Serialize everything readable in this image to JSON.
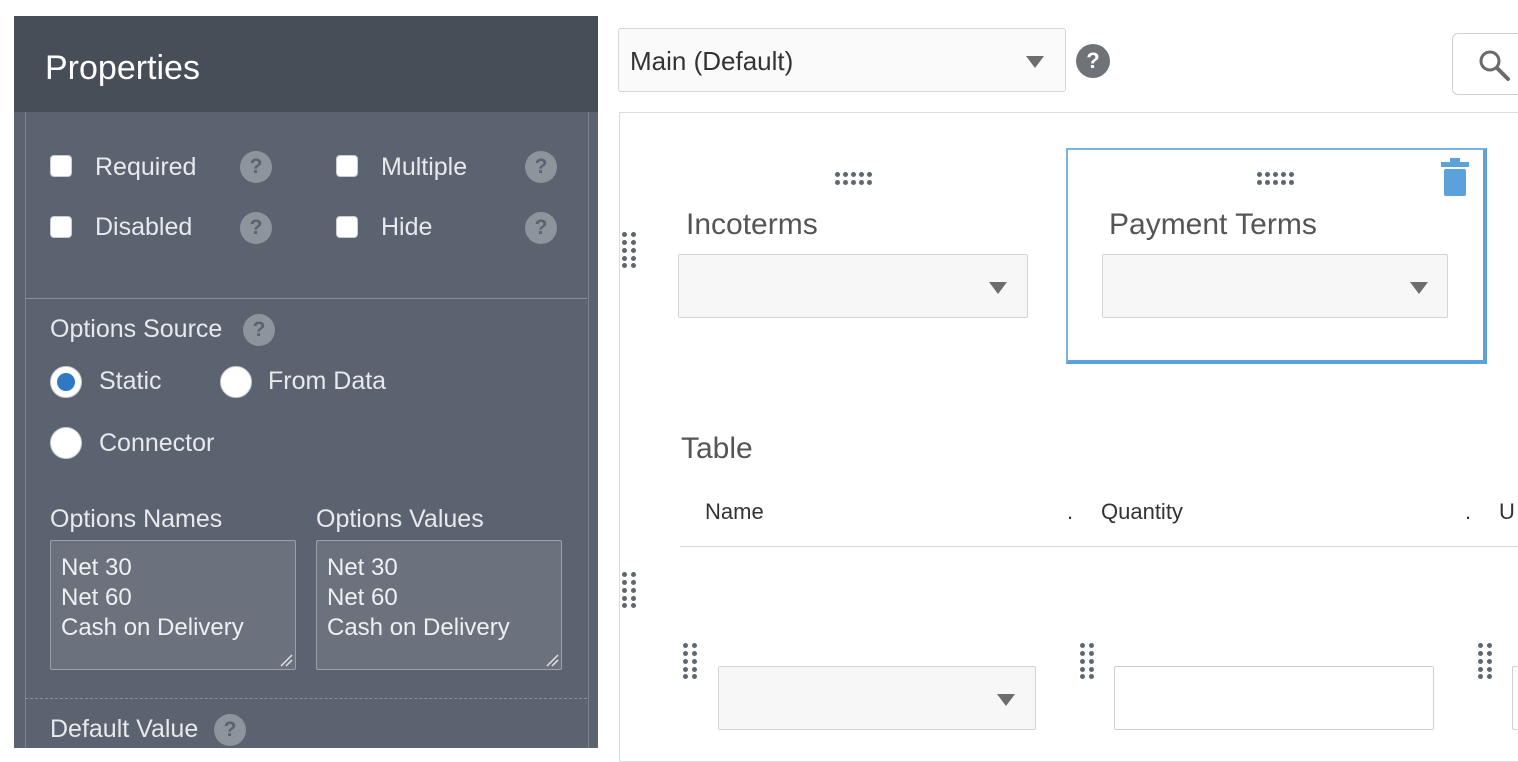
{
  "properties_panel": {
    "title": "Properties",
    "checkboxes": [
      {
        "label": "Required",
        "checked": false
      },
      {
        "label": "Multiple",
        "checked": false
      },
      {
        "label": "Disabled",
        "checked": false
      },
      {
        "label": "Hide",
        "checked": false
      }
    ],
    "options_source": {
      "label": "Options Source",
      "radios": [
        {
          "label": "Static",
          "selected": true
        },
        {
          "label": "From Data",
          "selected": false
        },
        {
          "label": "Connector",
          "selected": false
        }
      ]
    },
    "options_names": {
      "label": "Options Names",
      "lines": [
        "Net 30",
        "Net 60",
        "Cash on Delivery"
      ]
    },
    "options_values": {
      "label": "Options Values",
      "lines": [
        "Net 30",
        "Net 60",
        "Cash on Delivery"
      ]
    },
    "default_value": {
      "label": "Default Value"
    },
    "help_glyph": "?"
  },
  "toolbar": {
    "page_select_value": "Main (Default)",
    "help_glyph": "?"
  },
  "form": {
    "fields": [
      {
        "label": "Incoterms",
        "value": ""
      },
      {
        "label": "Payment Terms",
        "value": ""
      }
    ],
    "table": {
      "label": "Table",
      "columns": [
        "Name",
        "Quantity",
        "U"
      ],
      "column_separator": "."
    }
  },
  "colors": {
    "panel_bg": "#5b6370",
    "panel_header_bg": "#474e58",
    "selection_border": "#5ba2dc",
    "radio_selected": "#2f78c4"
  },
  "icons": [
    "help-icon",
    "search-icon",
    "drag-handle-icon",
    "trash-icon",
    "chevron-down-icon",
    "resize-handle-icon"
  ]
}
